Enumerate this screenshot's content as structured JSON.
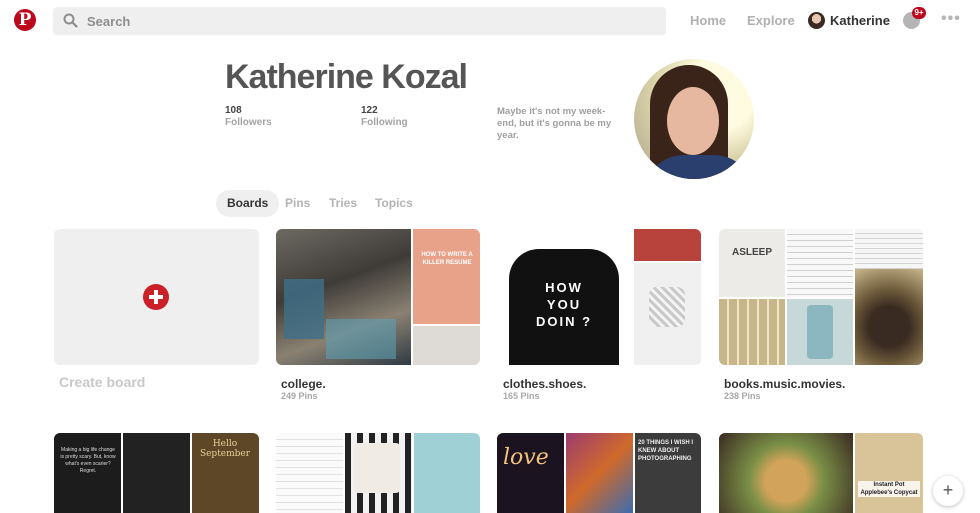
{
  "header": {
    "search_placeholder": "Search",
    "nav_home": "Home",
    "nav_explore": "Explore",
    "user_name": "Katherine",
    "notif_count": "9+",
    "more": "•••",
    "brand_color": "#bd081c"
  },
  "profile": {
    "name": "Katherine Kozal",
    "followers_count": "108",
    "followers_label": "Followers",
    "following_count": "122",
    "following_label": "Following",
    "bio": "Maybe it's not my week-end, but it's gonna be my year."
  },
  "tabs": [
    {
      "label": "Boards",
      "active": true
    },
    {
      "label": "Pins",
      "active": false
    },
    {
      "label": "Tries",
      "active": false
    },
    {
      "label": "Topics",
      "active": false
    }
  ],
  "create_board": {
    "label": "Create board"
  },
  "boards": [
    {
      "title": "college.",
      "count": "249 Pins",
      "overlay_text": "HOW TO WRITE A KILLER RESUME"
    },
    {
      "title": "clothes.shoes.",
      "count": "165 Pins",
      "overlay_text": "HOW YOU DOIN ?"
    },
    {
      "title": "books.music.movies.",
      "count": "238 Pins",
      "overlay_text": "ASLEEP"
    }
  ],
  "row2_overlays": {
    "c1a": "Making a big life change is pretty scary. But, know what's even scarier? Regret.",
    "c1b": "Hello September",
    "c3a": "love",
    "c3b": "20 THINGS I WISH I KNEW ABOUT PHOTOGRAPHING",
    "c4b": "Instant Pot Applebee's Copycat"
  },
  "fab": "+"
}
